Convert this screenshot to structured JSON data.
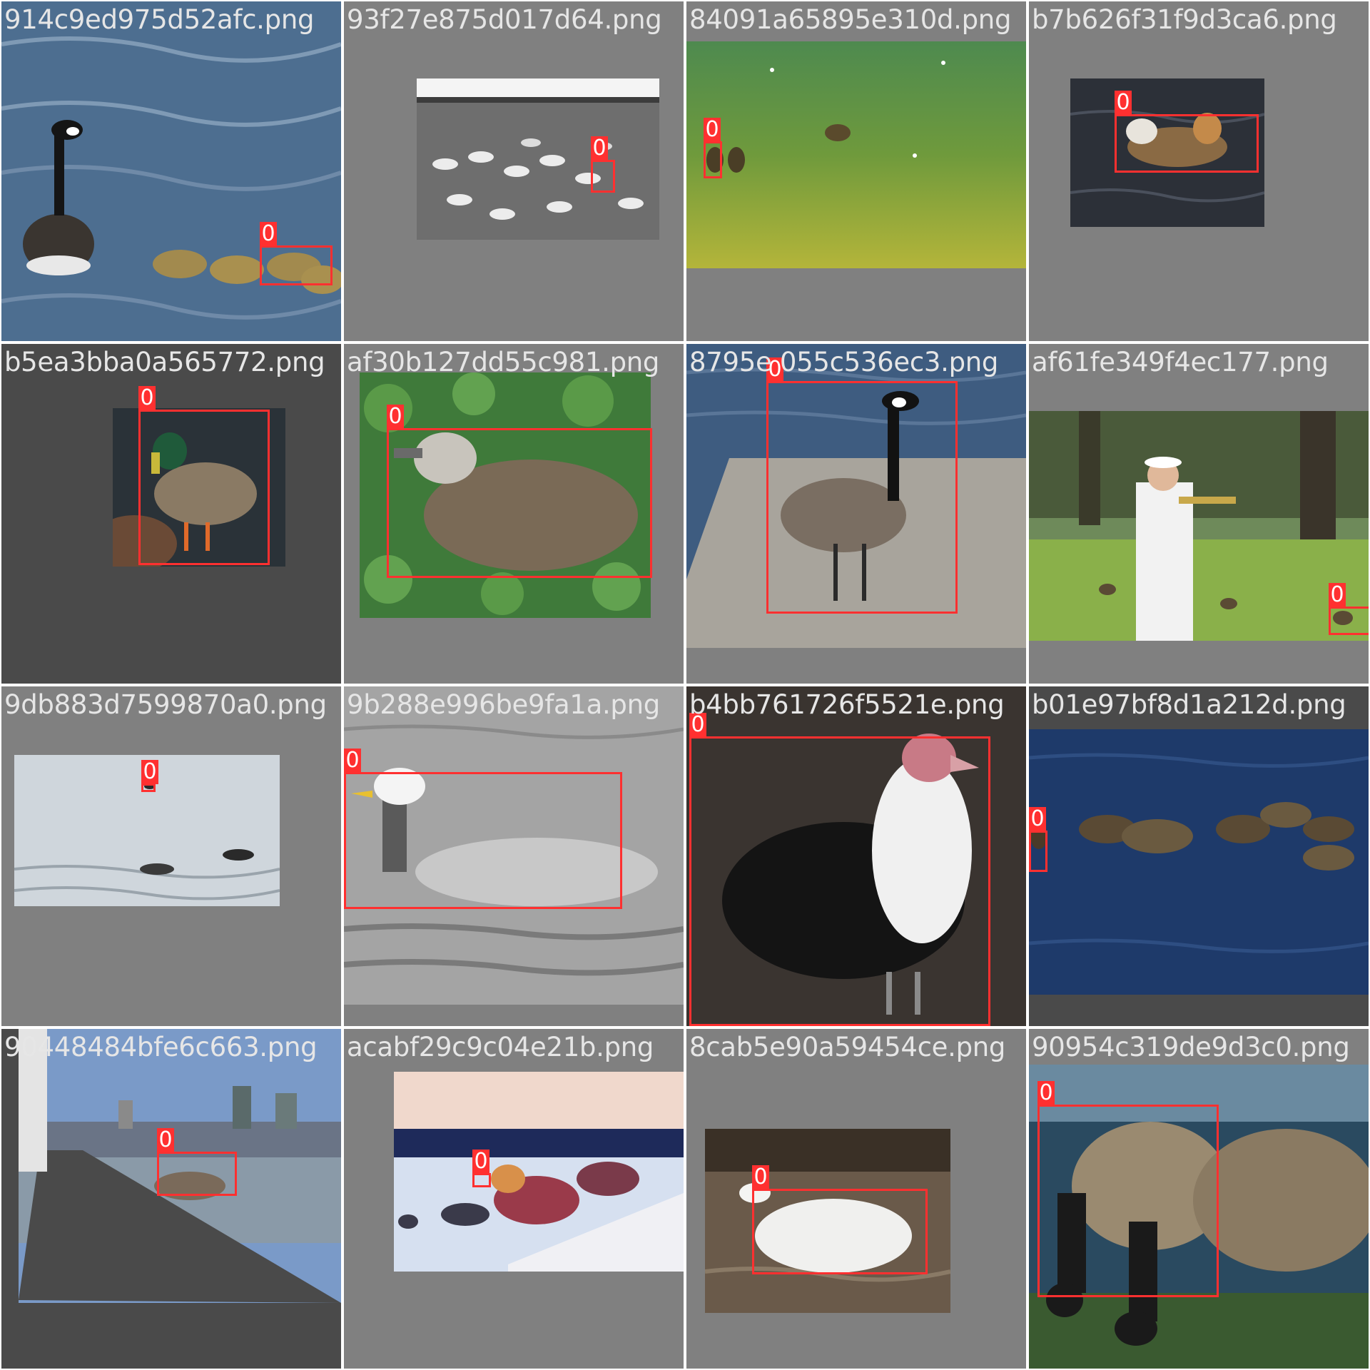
{
  "tiles": [
    {
      "filename": "914c9ed975d52afc.png",
      "label": "0"
    },
    {
      "filename": "93f27e875d017d64.png",
      "label": "0"
    },
    {
      "filename": "84091a65895e310d.png",
      "label": "0"
    },
    {
      "filename": "b7b626f31f9d3ca6.png",
      "label": "0"
    },
    {
      "filename": "b5ea3bba0a565772.png",
      "label": "0"
    },
    {
      "filename": "af30b127dd55c981.png",
      "label": "0"
    },
    {
      "filename": "8795e 055c536ec3.png",
      "label": "0"
    },
    {
      "filename": "af61fe349f4ec177.png",
      "label": "0"
    },
    {
      "filename": "9db883d7599870a0.png",
      "label": "0"
    },
    {
      "filename": "9b288e996be9fa1a.png",
      "label": "0"
    },
    {
      "filename": "b4bb761726f5521e.png",
      "label": "0"
    },
    {
      "filename": "b01e97bf8d1a212d.png",
      "label": "0"
    },
    {
      "filename": "90448484bfe6c663.png",
      "label": "0"
    },
    {
      "filename": "acabf29c9c04e21b.png",
      "label": "0"
    },
    {
      "filename": "8cab5e90a59454ce.png",
      "label": "0"
    },
    {
      "filename": "90954c319de9d3c0.png",
      "label": "0"
    }
  ],
  "colors": {
    "box": "#ff3030",
    "tile_background": "#808080",
    "tile_background_dark": "#4a4a4a",
    "filename_text": "#e6e6e6"
  }
}
